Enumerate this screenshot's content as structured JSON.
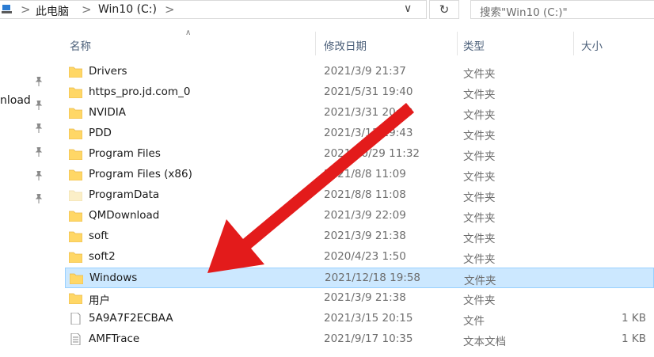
{
  "address_bar": {
    "crumbs": [
      "此电脑",
      "Win10 (C:)"
    ],
    "separator": ">",
    "dropdown_glyph": "∨",
    "refresh_glyph": "↻"
  },
  "search": {
    "placeholder": "搜索\"Win10 (C:)\""
  },
  "nav": {
    "partial_label": "nload",
    "pin_count": 6
  },
  "columns": {
    "name": "名称",
    "date": "修改日期",
    "type": "类型",
    "size": "大小"
  },
  "files": [
    {
      "name": "Drivers",
      "date": "2021/3/9 21:37",
      "type": "文件夹",
      "size": "",
      "icon": "folder-icon"
    },
    {
      "name": "https_pro.jd.com_0",
      "date": "2021/5/31 19:40",
      "type": "文件夹",
      "size": "",
      "icon": "folder-icon"
    },
    {
      "name": "NVIDIA",
      "date": "2021/3/31 20:30",
      "type": "文件夹",
      "size": "",
      "icon": "folder-icon"
    },
    {
      "name": "PDD",
      "date": "2021/3/11 19:43",
      "type": "文件夹",
      "size": "",
      "icon": "folder-icon"
    },
    {
      "name": "Program Files",
      "date": "2021/10/29 11:32",
      "type": "文件夹",
      "size": "",
      "icon": "folder-icon"
    },
    {
      "name": "Program Files (x86)",
      "date": "2021/8/8 11:09",
      "type": "文件夹",
      "size": "",
      "icon": "folder-icon"
    },
    {
      "name": "ProgramData",
      "date": "2021/8/8 11:08",
      "type": "文件夹",
      "size": "",
      "icon": "folder-hidden-icon"
    },
    {
      "name": "QMDownload",
      "date": "2021/3/9 22:09",
      "type": "文件夹",
      "size": "",
      "icon": "folder-icon"
    },
    {
      "name": "soft",
      "date": "2021/3/9 21:38",
      "type": "文件夹",
      "size": "",
      "icon": "folder-icon"
    },
    {
      "name": "soft2",
      "date": "2020/4/23 1:50",
      "type": "文件夹",
      "size": "",
      "icon": "folder-icon"
    },
    {
      "name": "Windows",
      "date": "2021/12/18 19:58",
      "type": "文件夹",
      "size": "",
      "icon": "folder-icon",
      "selected": true
    },
    {
      "name": "用户",
      "date": "2021/3/9 21:38",
      "type": "文件夹",
      "size": "",
      "icon": "folder-icon"
    },
    {
      "name": "5A9A7F2ECBAA",
      "date": "2021/3/15 20:15",
      "type": "文件",
      "size": "1 KB",
      "icon": "file-icon"
    },
    {
      "name": "AMFTrace",
      "date": "2021/9/17 10:35",
      "type": "文本文档",
      "size": "1 KB",
      "icon": "text-file-icon"
    }
  ],
  "colors": {
    "selection_bg": "#cce8ff",
    "selection_border": "#99d1ff",
    "folder": "#ffd766",
    "header_text": "#4c607a",
    "annotation_arrow": "#e31b1b"
  }
}
